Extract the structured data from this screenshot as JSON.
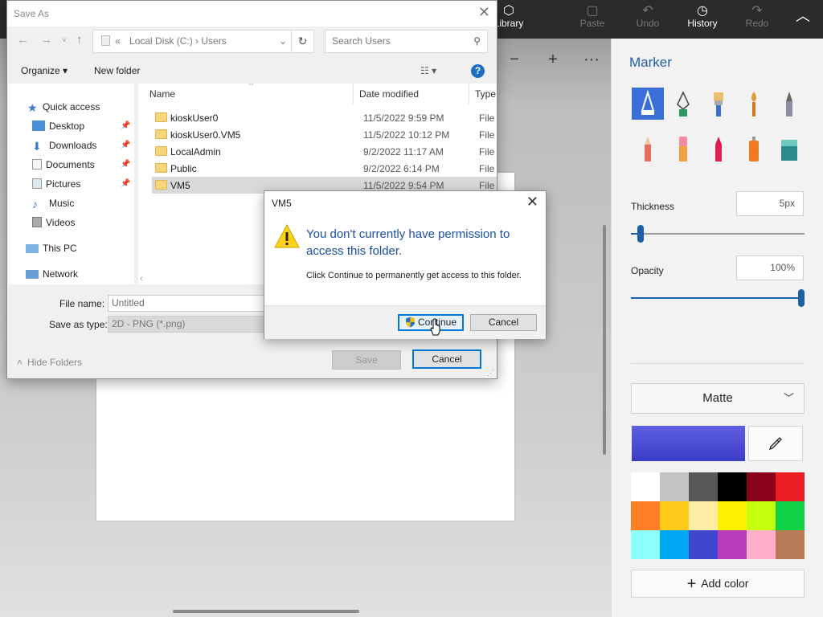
{
  "app": {
    "toolbar": [
      {
        "label": "Library",
        "icon": "cube-icon"
      },
      {
        "label": "Paste",
        "icon": "clipboard-icon"
      },
      {
        "label": "Undo",
        "icon": "undo-icon"
      },
      {
        "label": "History",
        "icon": "history-icon"
      },
      {
        "label": "Redo",
        "icon": "redo-icon"
      }
    ],
    "canvas_tools": {
      "zoom_out": "−",
      "zoom_in": "+",
      "more": "···"
    }
  },
  "panel": {
    "title": "Marker",
    "thickness_label": "Thickness",
    "thickness_value": "5px",
    "thickness_level": 0.05,
    "opacity_label": "Opacity",
    "opacity_value": "100%",
    "opacity_level": 1.0,
    "finish": "Matte",
    "current_color": "#3b3cc4",
    "palette": [
      "#ffffff",
      "#c3c3c3",
      "#585858",
      "#000000",
      "#88001b",
      "#ec1c24",
      "#ff7f27",
      "#ffca18",
      "#fdeca6",
      "#fff200",
      "#c4ff0e",
      "#0ed145",
      "#8cfffb",
      "#00a8f3",
      "#3f48cc",
      "#b83dba",
      "#ffaec8",
      "#b97a57"
    ],
    "add_color_label": "Add color"
  },
  "save_as": {
    "title": "Save As",
    "address": "Local Disk (C:)  ›  Users",
    "address_prefix": "«",
    "search_placeholder": "Search Users",
    "organize_label": "Organize ▾",
    "new_folder_label": "New folder",
    "nav": {
      "quick_access": "Quick access",
      "desktop": "Desktop",
      "downloads": "Downloads",
      "documents": "Documents",
      "pictures": "Pictures",
      "music": "Music",
      "videos": "Videos",
      "this_pc": "This PC",
      "network": "Network"
    },
    "columns": {
      "name": "Name",
      "date": "Date modified",
      "type": "Type"
    },
    "files": [
      {
        "name": "kioskUser0",
        "date": "11/5/2022 9:59 PM",
        "type": "File fo"
      },
      {
        "name": "kioskUser0.VM5",
        "date": "11/5/2022 10:12 PM",
        "type": "File fo"
      },
      {
        "name": "LocalAdmin",
        "date": "9/2/2022 11:17 AM",
        "type": "File fo"
      },
      {
        "name": "Public",
        "date": "9/2/2022 6:14 PM",
        "type": "File fo"
      },
      {
        "name": "VM5",
        "date": "11/5/2022 9:54 PM",
        "type": "File fo"
      }
    ],
    "file_name_label": "File name:",
    "file_name_value": "Untitled",
    "save_type_label": "Save as type:",
    "save_type_value": "2D - PNG (*.png)",
    "hide_folders_label": "Hide Folders",
    "save_label": "Save",
    "cancel_label": "Cancel"
  },
  "permission": {
    "title": "VM5",
    "message": "You don't currently have permission to access this folder.",
    "detail": "Click Continue to permanently get access to this folder.",
    "continue_label": "Continue",
    "cancel_label": "Cancel"
  }
}
